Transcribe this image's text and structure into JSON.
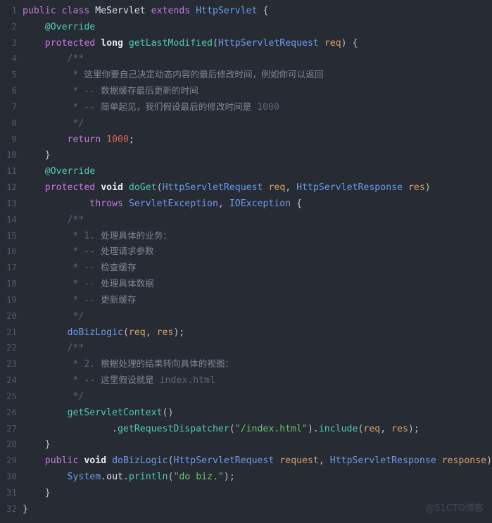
{
  "editor": {
    "language": "java",
    "theme_background": "#272c34",
    "gutter_background": "#262b33",
    "line_number_color": "#4e5a68",
    "total_lines": 32
  },
  "watermark": {
    "text": "@51CTO博客"
  },
  "lines": [
    {
      "n": "1",
      "tokens": [
        {
          "t": "public",
          "c": "kw"
        },
        {
          "t": " ",
          "c": "plain"
        },
        {
          "t": "class",
          "c": "kw"
        },
        {
          "t": " ",
          "c": "plain"
        },
        {
          "t": "MeServlet",
          "c": "cls"
        },
        {
          "t": " ",
          "c": "plain"
        },
        {
          "t": "extends",
          "c": "kw"
        },
        {
          "t": " ",
          "c": "plain"
        },
        {
          "t": "HttpServlet",
          "c": "type"
        },
        {
          "t": " {",
          "c": "punc"
        }
      ]
    },
    {
      "n": "2",
      "tokens": [
        {
          "t": "    ",
          "c": "plain"
        },
        {
          "t": "@Override",
          "c": "ann"
        }
      ]
    },
    {
      "n": "3",
      "tokens": [
        {
          "t": "    ",
          "c": "plain"
        },
        {
          "t": "protected",
          "c": "kw"
        },
        {
          "t": " ",
          "c": "plain"
        },
        {
          "t": "long",
          "c": "kwb"
        },
        {
          "t": " ",
          "c": "plain"
        },
        {
          "t": "getLastModified",
          "c": "fn"
        },
        {
          "t": "(",
          "c": "punc"
        },
        {
          "t": "HttpServletRequest",
          "c": "type"
        },
        {
          "t": " ",
          "c": "plain"
        },
        {
          "t": "req",
          "c": "param"
        },
        {
          "t": ") {",
          "c": "punc"
        }
      ]
    },
    {
      "n": "4",
      "tokens": [
        {
          "t": "        /**",
          "c": "cmt"
        }
      ]
    },
    {
      "n": "5",
      "tokens": [
        {
          "t": "         * ",
          "c": "cmt"
        },
        {
          "t": "这里你要自己决定动态内容的最后修改时间，例如你可以返回",
          "c": "cmtcn",
          "cjk": true
        }
      ]
    },
    {
      "n": "6",
      "tokens": [
        {
          "t": "         * -- ",
          "c": "cmt"
        },
        {
          "t": "数据缓存最后更新的时间",
          "c": "cmtcn",
          "cjk": true
        }
      ]
    },
    {
      "n": "7",
      "tokens": [
        {
          "t": "         * -- ",
          "c": "cmt"
        },
        {
          "t": "简单起见，我们假设最后的修改时间是",
          "c": "cmtcn",
          "cjk": true
        },
        {
          "t": " 1000",
          "c": "cmt"
        }
      ]
    },
    {
      "n": "8",
      "tokens": [
        {
          "t": "         */",
          "c": "cmt"
        }
      ]
    },
    {
      "n": "9",
      "tokens": [
        {
          "t": "        ",
          "c": "plain"
        },
        {
          "t": "return",
          "c": "kw"
        },
        {
          "t": " ",
          "c": "plain"
        },
        {
          "t": "1000",
          "c": "num"
        },
        {
          "t": ";",
          "c": "punc"
        }
      ]
    },
    {
      "n": "10",
      "tokens": [
        {
          "t": "    }",
          "c": "punc"
        }
      ]
    },
    {
      "n": "11",
      "tokens": [
        {
          "t": "    ",
          "c": "plain"
        },
        {
          "t": "@Override",
          "c": "ann"
        }
      ]
    },
    {
      "n": "12",
      "tokens": [
        {
          "t": "    ",
          "c": "plain"
        },
        {
          "t": "protected",
          "c": "kw"
        },
        {
          "t": " ",
          "c": "plain"
        },
        {
          "t": "void",
          "c": "kwb"
        },
        {
          "t": " ",
          "c": "plain"
        },
        {
          "t": "doGet",
          "c": "fn"
        },
        {
          "t": "(",
          "c": "punc"
        },
        {
          "t": "HttpServletRequest",
          "c": "type"
        },
        {
          "t": " ",
          "c": "plain"
        },
        {
          "t": "req",
          "c": "param"
        },
        {
          "t": ", ",
          "c": "punc"
        },
        {
          "t": "HttpServletResponse",
          "c": "type"
        },
        {
          "t": " ",
          "c": "plain"
        },
        {
          "t": "res",
          "c": "param"
        },
        {
          "t": ")",
          "c": "punc"
        }
      ]
    },
    {
      "n": "13",
      "tokens": [
        {
          "t": "            ",
          "c": "plain"
        },
        {
          "t": "throws",
          "c": "kw"
        },
        {
          "t": " ",
          "c": "plain"
        },
        {
          "t": "ServletException",
          "c": "type"
        },
        {
          "t": ", ",
          "c": "punc"
        },
        {
          "t": "IOException",
          "c": "type"
        },
        {
          "t": " {",
          "c": "punc"
        }
      ]
    },
    {
      "n": "14",
      "tokens": [
        {
          "t": "        /**",
          "c": "cmt"
        }
      ]
    },
    {
      "n": "15",
      "tokens": [
        {
          "t": "         * 1. ",
          "c": "cmt"
        },
        {
          "t": "处理具体的业务：",
          "c": "cmtcn",
          "cjk": true
        }
      ]
    },
    {
      "n": "16",
      "tokens": [
        {
          "t": "         * -- ",
          "c": "cmt"
        },
        {
          "t": "处理请求参数",
          "c": "cmtcn",
          "cjk": true
        }
      ]
    },
    {
      "n": "17",
      "tokens": [
        {
          "t": "         * -- ",
          "c": "cmt"
        },
        {
          "t": "检查缓存",
          "c": "cmtcn",
          "cjk": true
        }
      ]
    },
    {
      "n": "18",
      "tokens": [
        {
          "t": "         * -- ",
          "c": "cmt"
        },
        {
          "t": "处理具体数据",
          "c": "cmtcn",
          "cjk": true
        }
      ]
    },
    {
      "n": "19",
      "tokens": [
        {
          "t": "         * -- ",
          "c": "cmt"
        },
        {
          "t": "更新缓存",
          "c": "cmtcn",
          "cjk": true
        }
      ]
    },
    {
      "n": "20",
      "tokens": [
        {
          "t": "         */",
          "c": "cmt"
        }
      ]
    },
    {
      "n": "21",
      "tokens": [
        {
          "t": "        ",
          "c": "plain"
        },
        {
          "t": "doBizLogic",
          "c": "call"
        },
        {
          "t": "(",
          "c": "punc"
        },
        {
          "t": "req",
          "c": "param"
        },
        {
          "t": ", ",
          "c": "punc"
        },
        {
          "t": "res",
          "c": "param"
        },
        {
          "t": ");",
          "c": "punc"
        }
      ]
    },
    {
      "n": "22",
      "tokens": [
        {
          "t": "        /**",
          "c": "cmt"
        }
      ]
    },
    {
      "n": "23",
      "tokens": [
        {
          "t": "         * 2. ",
          "c": "cmt"
        },
        {
          "t": "根据处理的结果转向具体的视图：",
          "c": "cmtcn",
          "cjk": true
        }
      ]
    },
    {
      "n": "24",
      "tokens": [
        {
          "t": "         * -- ",
          "c": "cmt"
        },
        {
          "t": "这里假设就是",
          "c": "cmtcn",
          "cjk": true
        },
        {
          "t": " index.html",
          "c": "cmt"
        }
      ]
    },
    {
      "n": "25",
      "tokens": [
        {
          "t": "         */",
          "c": "cmt"
        }
      ]
    },
    {
      "n": "26",
      "tokens": [
        {
          "t": "        ",
          "c": "plain"
        },
        {
          "t": "getServletContext",
          "c": "fn"
        },
        {
          "t": "()",
          "c": "punc"
        }
      ]
    },
    {
      "n": "27",
      "tokens": [
        {
          "t": "                .",
          "c": "punc"
        },
        {
          "t": "getRequestDispatcher",
          "c": "fn"
        },
        {
          "t": "(",
          "c": "punc"
        },
        {
          "t": "\"/index.html\"",
          "c": "str"
        },
        {
          "t": ").",
          "c": "punc"
        },
        {
          "t": "include",
          "c": "fn"
        },
        {
          "t": "(",
          "c": "punc"
        },
        {
          "t": "req",
          "c": "param"
        },
        {
          "t": ", ",
          "c": "punc"
        },
        {
          "t": "res",
          "c": "param"
        },
        {
          "t": ");",
          "c": "punc"
        }
      ]
    },
    {
      "n": "28",
      "tokens": [
        {
          "t": "    }",
          "c": "punc"
        }
      ]
    },
    {
      "n": "29",
      "tokens": [
        {
          "t": "    ",
          "c": "plain"
        },
        {
          "t": "public",
          "c": "kw"
        },
        {
          "t": " ",
          "c": "plain"
        },
        {
          "t": "void",
          "c": "kwb"
        },
        {
          "t": " ",
          "c": "plain"
        },
        {
          "t": "doBizLogic",
          "c": "call"
        },
        {
          "t": "(",
          "c": "punc"
        },
        {
          "t": "HttpServletRequest",
          "c": "type"
        },
        {
          "t": " ",
          "c": "plain"
        },
        {
          "t": "request",
          "c": "param"
        },
        {
          "t": ", ",
          "c": "punc"
        },
        {
          "t": "HttpServletResponse",
          "c": "type"
        },
        {
          "t": " ",
          "c": "plain"
        },
        {
          "t": "response",
          "c": "param"
        },
        {
          "t": ") {",
          "c": "punc"
        }
      ]
    },
    {
      "n": "30",
      "tokens": [
        {
          "t": "        ",
          "c": "plain"
        },
        {
          "t": "System",
          "c": "type"
        },
        {
          "t": ".",
          "c": "punc"
        },
        {
          "t": "out",
          "c": "field"
        },
        {
          "t": ".",
          "c": "punc"
        },
        {
          "t": "println",
          "c": "fn"
        },
        {
          "t": "(",
          "c": "punc"
        },
        {
          "t": "\"do biz.\"",
          "c": "str"
        },
        {
          "t": ");",
          "c": "punc"
        }
      ]
    },
    {
      "n": "31",
      "tokens": [
        {
          "t": "    }",
          "c": "punc"
        }
      ]
    },
    {
      "n": "32",
      "tokens": [
        {
          "t": "}",
          "c": "punc"
        }
      ]
    }
  ],
  "source_text": "public class MeServlet extends HttpServlet {\n    @Override\n    protected long getLastModified(HttpServletRequest req) {\n        /**\n         * 这里你要自己决定动态内容的最后修改时间，例如你可以返回\n         * -- 数据缓存最后更新的时间\n         * -- 简单起见，我们假设最后的修改时间是 1000\n         */\n        return 1000;\n    }\n    @Override\n    protected void doGet(HttpServletRequest req, HttpServletResponse res)\n            throws ServletException, IOException {\n        /**\n         * 1. 处理具体的业务：\n         * -- 处理请求参数\n         * -- 检查缓存\n         * -- 处理具体数据\n         * -- 更新缓存\n         */\n        doBizLogic(req, res);\n        /**\n         * 2. 根据处理的结果转向具体的视图：\n         * -- 这里假设就是 index.html\n         */\n        getServletContext()\n                .getRequestDispatcher(\"/index.html\").include(req, res);\n    }\n    public void doBizLogic(HttpServletRequest request, HttpServletResponse response) {\n        System.out.println(\"do biz.\");\n    }\n}"
}
